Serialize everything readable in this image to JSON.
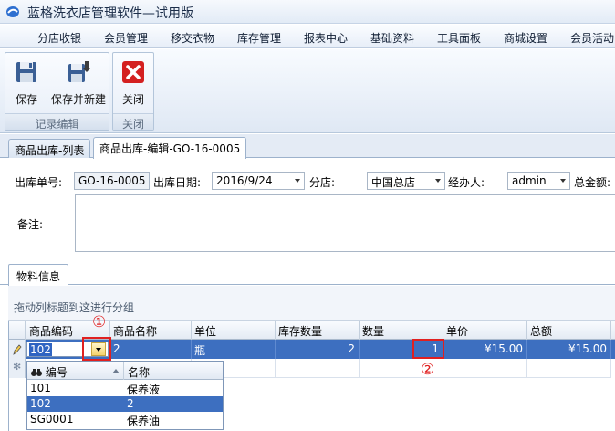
{
  "window": {
    "title": "蓝格洗衣店管理软件—试用版",
    "accent_color": "#3d6fc0"
  },
  "menu": {
    "items": [
      "分店收银",
      "会员管理",
      "移交衣物",
      "库存管理",
      "报表中心",
      "基础资料",
      "工具面板",
      "商城设置",
      "会员活动"
    ]
  },
  "ribbon": {
    "groups": [
      {
        "caption": "记录编辑",
        "buttons": [
          {
            "label": "保存",
            "icon": "save-icon"
          },
          {
            "label": "保存并新建",
            "icon": "save-new-icon"
          }
        ]
      },
      {
        "caption": "关闭",
        "buttons": [
          {
            "label": "关闭",
            "icon": "close-icon"
          }
        ]
      }
    ]
  },
  "doc_tabs": [
    "商品出库-列表",
    "商品出库-编辑-GO-16-0005"
  ],
  "form": {
    "order_no_label": "出库单号:",
    "order_no": "GO-16-0005",
    "date_label": "出库日期:",
    "date": "2016/9/24",
    "branch_label": "分店:",
    "branch": "中国总店",
    "handler_label": "经办人:",
    "handler": "admin",
    "total_label": "总金额:",
    "remark_label": "备注:"
  },
  "sub_tab": "物料信息",
  "grid": {
    "group_hint": "拖动列标题到这进行分组",
    "columns": [
      "商品编码",
      "商品名称",
      "单位",
      "库存数量",
      "数量",
      "单价",
      "总额"
    ],
    "rows": [
      {
        "code": "102",
        "name": "2",
        "unit": "瓶",
        "stock": "2",
        "qty": "1",
        "price": "¥15.00",
        "total": "¥15.00"
      }
    ]
  },
  "annotations": [
    "①",
    "②"
  ],
  "dropdown": {
    "columns": [
      "编号",
      "名称"
    ],
    "rows": [
      {
        "code": "101",
        "name": "保养液",
        "selected": false
      },
      {
        "code": "102",
        "name": "2",
        "selected": true
      },
      {
        "code": "SG0001",
        "name": "保养油",
        "selected": false
      }
    ]
  }
}
